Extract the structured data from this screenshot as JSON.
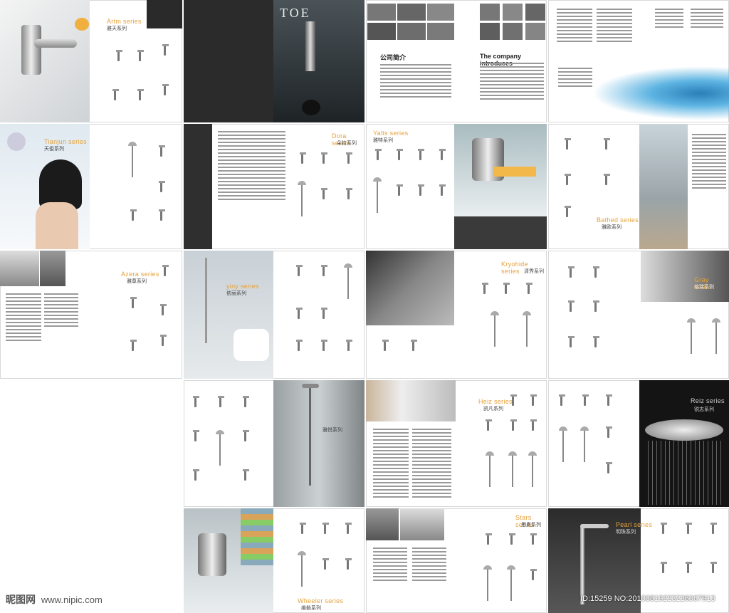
{
  "page": {
    "watermark_cn": "昵图网",
    "watermark_url": "www.nipic.com",
    "id_tag": "ID:15259 NO:20100819223226067913"
  },
  "spreads": [
    {
      "en": "Artm series",
      "cn": "雅天系列"
    },
    {
      "brand": "TOE"
    },
    {
      "intro_cn": "公司简介",
      "intro_en": "The company introduces"
    },
    {
      "en": "Tianjun series",
      "cn": "天俊系列"
    },
    {
      "en": "Dora series",
      "cn": "朵拉系列"
    },
    {
      "en": "Yalts series",
      "cn": "雅特系列"
    },
    {
      "en": "Bathed series",
      "cn": "雅欧系列"
    },
    {
      "en": "Azera series",
      "cn": "雅尊系列"
    },
    {
      "en": "yiny series",
      "cn": "依丽系列"
    },
    {
      "en": "Kryohide series",
      "cn": "清秀系列"
    },
    {
      "en": "Gray series",
      "cn": "格瑞系列"
    },
    {
      "en": "",
      "cn": "雅悦系列"
    },
    {
      "en": "Heiz series",
      "cn": "凯凡系列"
    },
    {
      "en": "Reiz series",
      "cn": "锐志系列"
    },
    {
      "en": "Wheeler series",
      "cn": "维勒系列"
    },
    {
      "en": "Stars series",
      "cn": "思奥系列"
    },
    {
      "en": "Pearl series",
      "cn": "明珠系列"
    }
  ]
}
